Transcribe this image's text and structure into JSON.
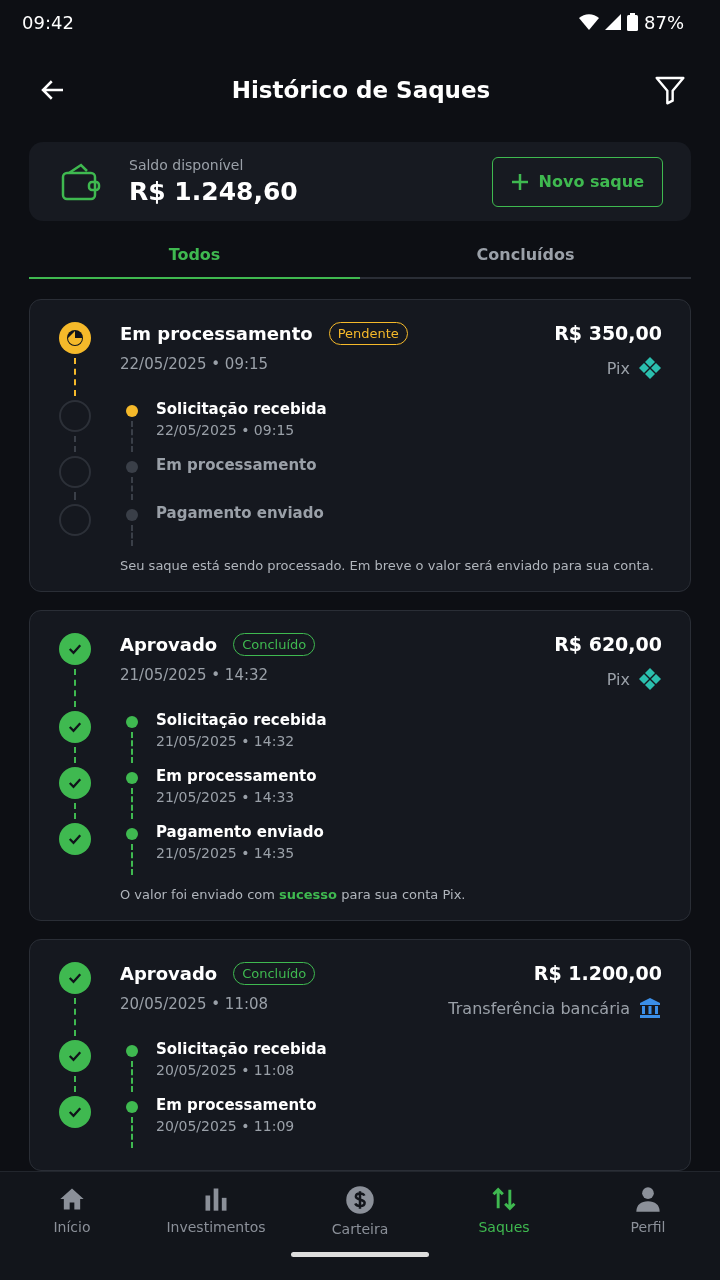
{
  "status_bar": {
    "time": "09:42",
    "battery": "87%"
  },
  "header": {
    "title": "Histórico de Saques"
  },
  "balance": {
    "label": "Saldo disponível",
    "amount": "R$ 1.248,60",
    "button": "Novo saque"
  },
  "tabs": [
    {
      "label": "Todos",
      "selected": true
    },
    {
      "label": "Concluídos",
      "selected": false
    }
  ],
  "withdrawals": [
    {
      "kind": "pending",
      "title": "Em processamento",
      "badge": "Pendente",
      "date": "22/05/2025 • 09:15",
      "amount": "R$ 350,00",
      "method": {
        "kind": "pix",
        "label": "Pix"
      },
      "steps": [
        {
          "label": "Solicitação recebida",
          "date": "22/05/2025 • 09:15",
          "kind": "current"
        },
        {
          "label": "Em processamento",
          "kind": "upcoming"
        },
        {
          "label": "Pagamento enviado",
          "kind": "upcoming"
        }
      ],
      "message": "Seu saque está sendo processado. Em breve o valor será enviado para sua conta."
    },
    {
      "kind": "done",
      "title": "Aprovado",
      "badge": "Concluído",
      "date": "21/05/2025 • 14:32",
      "amount": "R$ 620,00",
      "method": {
        "kind": "pix",
        "label": "Pix"
      },
      "steps": [
        {
          "label": "Solicitação recebida",
          "date": "21/05/2025 • 14:32",
          "kind": "done"
        },
        {
          "label": "Em processamento",
          "date": "21/05/2025 • 14:33",
          "kind": "done"
        },
        {
          "label": "Pagamento enviado",
          "date": "21/05/2025 • 14:35",
          "kind": "done"
        }
      ],
      "message": "O valor foi enviado com **sucesso** para sua conta Pix."
    },
    {
      "kind": "done",
      "title": "Aprovado",
      "badge": "Concluído",
      "date": "20/05/2025 • 11:08",
      "amount": "R$ 1.200,00",
      "method": {
        "kind": "bank",
        "label": "Transferência bancária"
      },
      "steps": [
        {
          "label": "Solicitação recebida",
          "date": "20/05/2025 • 11:08",
          "kind": "done"
        },
        {
          "label": "Em processamento",
          "date": "20/05/2025 • 11:09",
          "kind": "done"
        }
      ]
    }
  ],
  "nav": [
    {
      "kind": "home",
      "label": "Início",
      "selected": false
    },
    {
      "kind": "chart",
      "label": "Investimentos",
      "selected": false
    },
    {
      "kind": "wallet",
      "label": "Carteira",
      "selected": false
    },
    {
      "kind": "transfer",
      "label": "Saques",
      "selected": true
    },
    {
      "kind": "profile",
      "label": "Perfil",
      "selected": false
    }
  ]
}
